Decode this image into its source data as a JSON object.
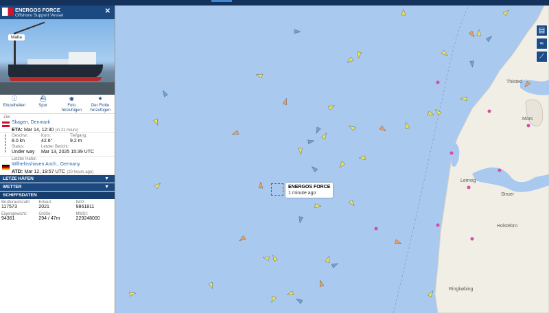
{
  "vessel": {
    "name": "ENERGOS FORCE",
    "type": "Offshore Support Vessel",
    "flag_tag": "Malta",
    "close": "✕"
  },
  "actions": [
    {
      "label": "Einzelheiten",
      "icon": "info-icon"
    },
    {
      "label": "Spur",
      "icon": "ship-track-icon"
    },
    {
      "label": "Foto hinzufügen",
      "icon": "camera-icon"
    },
    {
      "label": "Der Flotte hinzufügen",
      "icon": "star-icon"
    }
  ],
  "destination": {
    "label": "Ziel",
    "port": "Skagen, Denmark",
    "eta_prefix": "ETA:",
    "eta": "Mar 14, 12:30",
    "eta_rel": "(in 21 hours)"
  },
  "status": {
    "speed_label": "Geschw.:",
    "speed": "8.0 kn",
    "course_label": "Kurs:",
    "course": "42.6°",
    "draught_label": "Tiefgang:",
    "draught": "9.2 m",
    "status_label": "Status:",
    "status": "Under way",
    "report_label": "Letzter Bericht:",
    "report": "Mar 13, 2025 15:39 UTC"
  },
  "last_port": {
    "label": "Letzter Hafen",
    "port": "Wilhelmshaven Anch., Germany",
    "atd_prefix": "ATD:",
    "atd": "Mar 12, 19:57 UTC",
    "atd_rel": "(20 hours ago)"
  },
  "bars": [
    "LETZE HÄFEN",
    "WETTER",
    "SCHIFFSDATEN"
  ],
  "ship_data": {
    "gt_label": "Bruttoraumzahl:",
    "gt": "117573",
    "built_label": "Erbaut:",
    "built": "2021",
    "imo_label": "IMO:",
    "imo": "9861811",
    "dwt_label": "Eigengewicht:",
    "dwt": "94361",
    "size_label": "Größe:",
    "size": "294 / 47m",
    "mmsi_label": "MMSI:",
    "mmsi": "229248000"
  },
  "map": {
    "popup_title": "ENERGOS FORCE",
    "popup_time": "1 minute ago",
    "places": [
      "Thisted",
      "Mors",
      "Lemvig",
      "Struer",
      "Holstebro",
      "Ringkøbing"
    ],
    "colors": {
      "sea": "#a9c9ef",
      "land": "#f1eee6",
      "cargo": "#e8e35a",
      "passenger": "#6fa3d8",
      "tanker": "#f0a05a"
    }
  }
}
